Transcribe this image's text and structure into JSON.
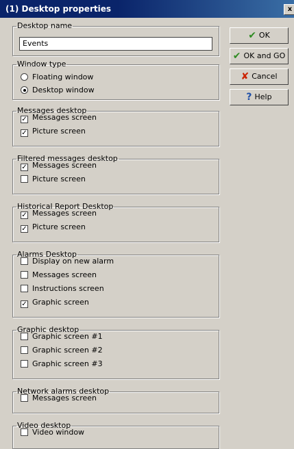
{
  "window": {
    "title": "(1) Desktop properties",
    "close_glyph": "x"
  },
  "desktop_name": {
    "label": "Desktop name",
    "value": "Events"
  },
  "window_type": {
    "label": "Window type",
    "options": [
      "Floating window",
      "Desktop window"
    ],
    "selected": "Desktop window"
  },
  "groups": [
    {
      "legend": "Messages desktop",
      "items": [
        {
          "label": "Messages screen",
          "checked": true
        },
        {
          "label": "Picture screen",
          "checked": true
        }
      ]
    },
    {
      "legend": "Filtered messages desktop",
      "items": [
        {
          "label": "Messages screen",
          "checked": true
        },
        {
          "label": "Picture screen",
          "checked": false
        }
      ]
    },
    {
      "legend": "Historical Report Desktop",
      "items": [
        {
          "label": "Messages screen",
          "checked": true
        },
        {
          "label": "Picture screen",
          "checked": true
        }
      ]
    },
    {
      "legend": "Alarms Desktop",
      "items": [
        {
          "label": "Display on new alarm",
          "checked": false
        },
        {
          "label": "Messages screen",
          "checked": false
        },
        {
          "label": "Instructions screen",
          "checked": false
        },
        {
          "label": "Graphic screen",
          "checked": true
        }
      ]
    },
    {
      "legend": "Graphic desktop",
      "items": [
        {
          "label": "Graphic screen #1",
          "checked": false
        },
        {
          "label": "Graphic screen #2",
          "checked": false
        },
        {
          "label": "Graphic screen #3",
          "checked": false
        }
      ]
    },
    {
      "legend": "Network alarms desktop",
      "items": [
        {
          "label": "Messages screen",
          "checked": false
        }
      ]
    },
    {
      "legend": "Video desktop",
      "items": [
        {
          "label": "Video window",
          "checked": false
        }
      ]
    }
  ],
  "buttons": {
    "ok": {
      "label": "OK",
      "icon": "check-icon",
      "color": "#2e8b22"
    },
    "ok_go": {
      "label": "OK and GO",
      "icon": "check-icon",
      "color": "#2e8b22"
    },
    "cancel": {
      "label": "Cancel",
      "icon": "x-icon",
      "color": "#cc2200"
    },
    "help": {
      "label": "Help",
      "icon": "question-icon",
      "color": "#1f4fa8"
    }
  }
}
